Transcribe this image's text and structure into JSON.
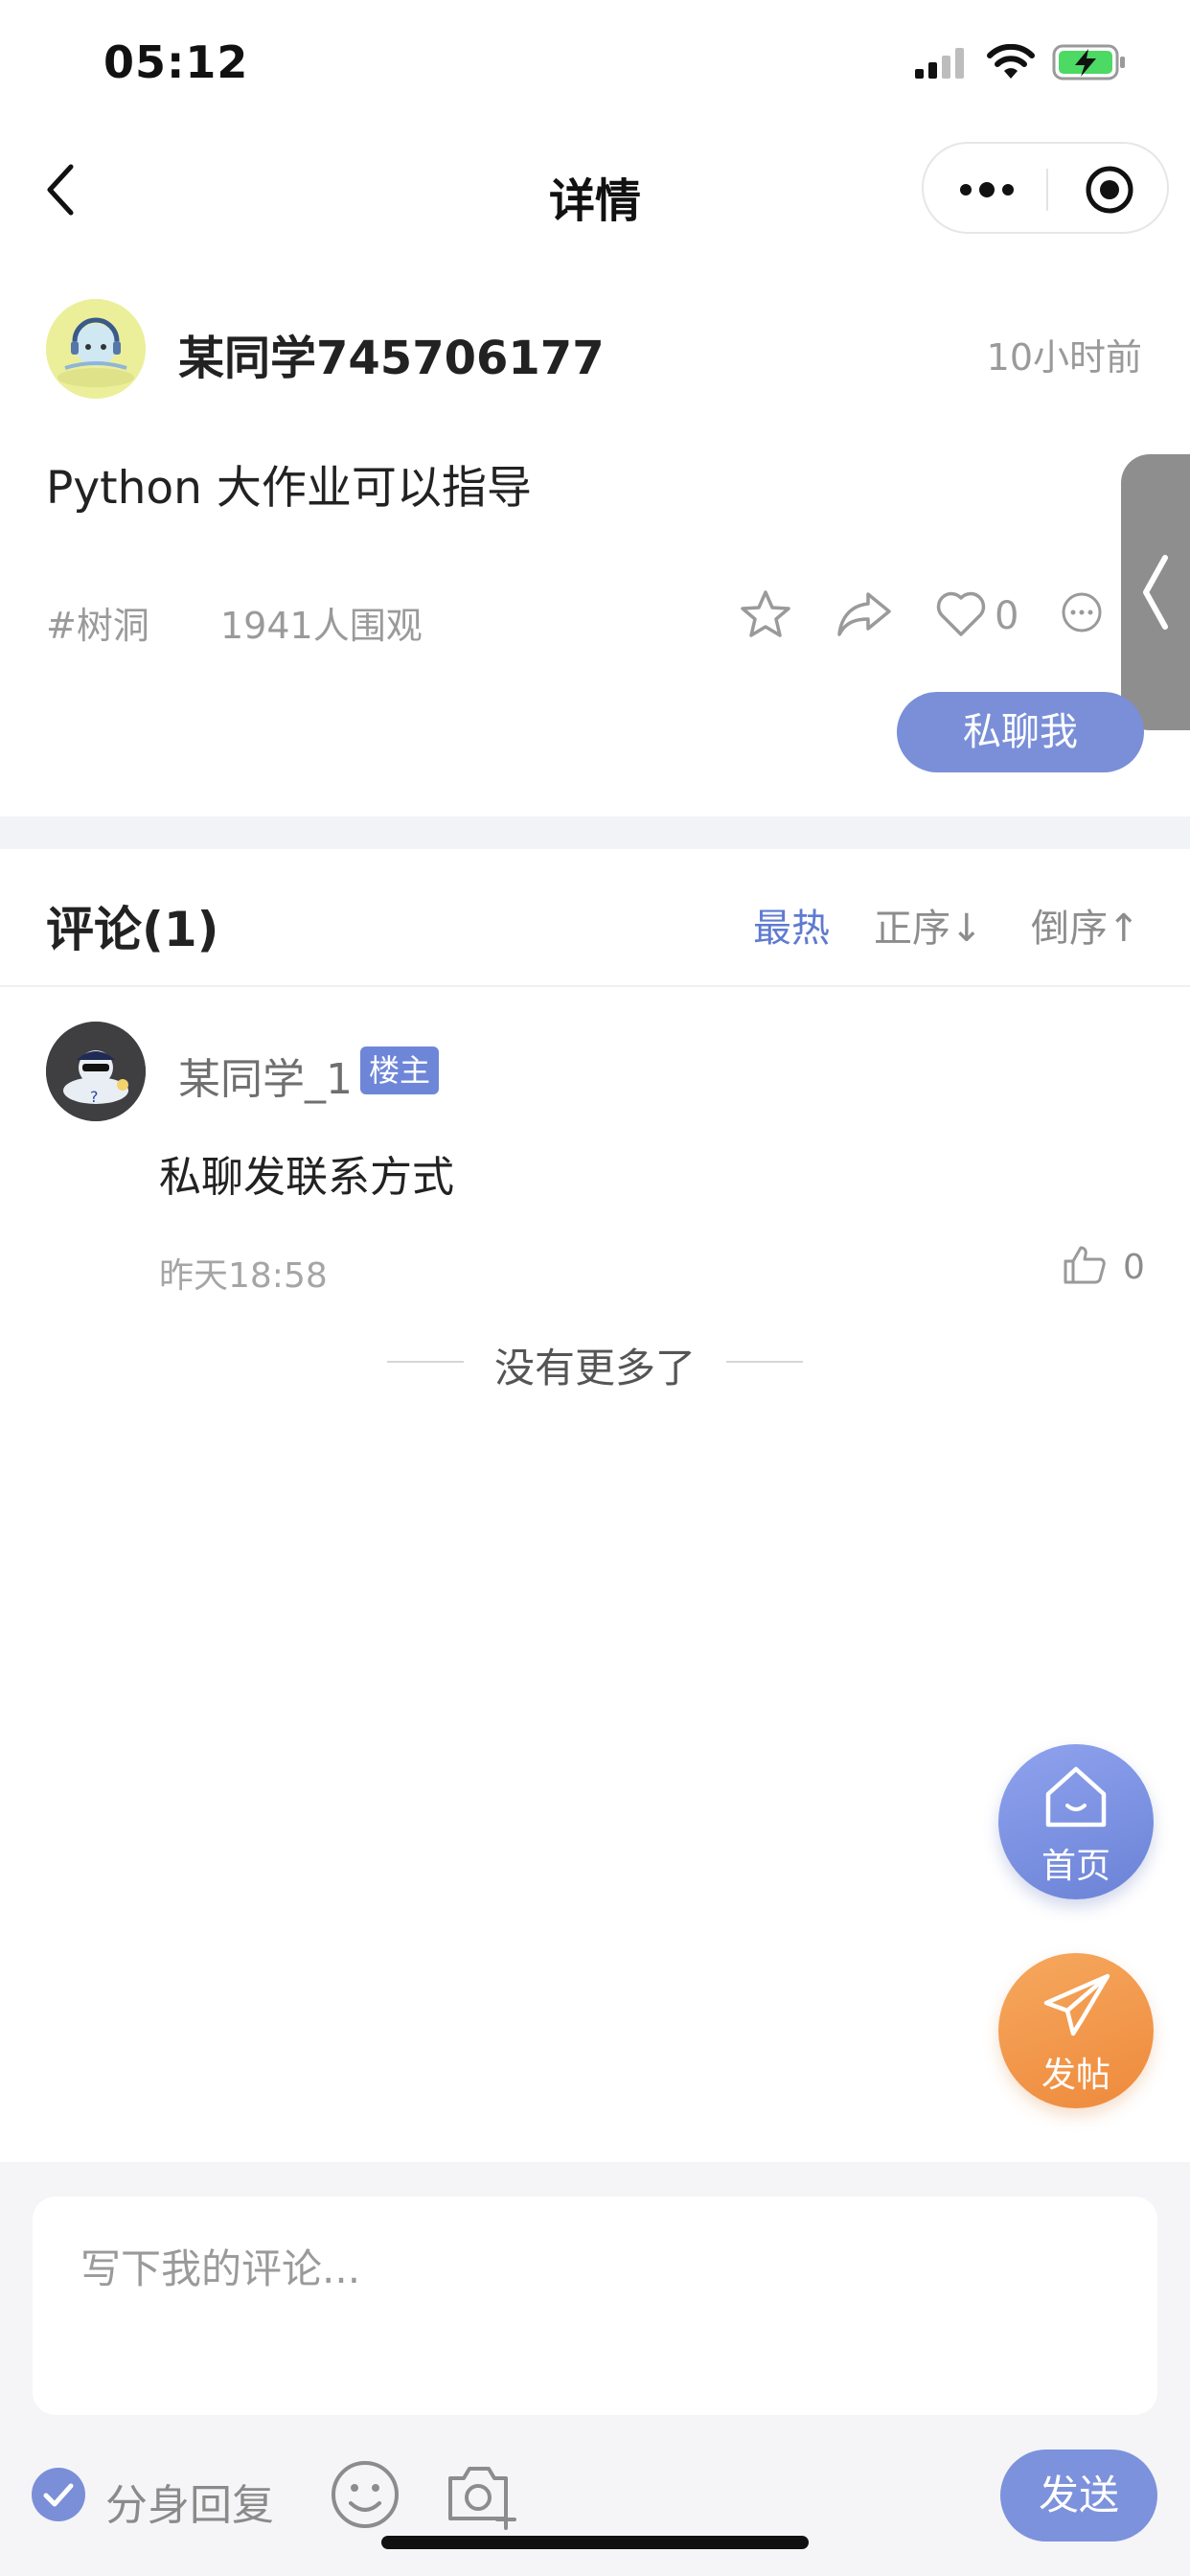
{
  "status_bar": {
    "time": "05:12"
  },
  "nav": {
    "title": "详情"
  },
  "post": {
    "author": "某同学745706177",
    "time": "10小时前",
    "content": "Python 大作业可以指导",
    "tag": "#树洞",
    "views": "1941人围观",
    "like_count": "0",
    "pm_button": "私聊我"
  },
  "comments": {
    "title": "评论(1)",
    "sort_hot": "最热",
    "sort_asc": "正序↓",
    "sort_desc": "倒序↑",
    "items": [
      {
        "name": "某同学_1",
        "badge": "楼主",
        "text": "私聊发联系方式",
        "time": "昨天18:58",
        "likes": "0"
      }
    ],
    "end_text": "没有更多了"
  },
  "fab": {
    "home": "首页",
    "post": "发帖"
  },
  "composer": {
    "placeholder": "写下我的评论...",
    "alias_reply": "分身回复",
    "send": "发送"
  },
  "colors": {
    "accent": "#7a8fd8",
    "sort_active": "#5f7ad0",
    "home_fab": "#6b82d6",
    "post_fab": "#ee8a3c",
    "battery": "#4cd964"
  }
}
